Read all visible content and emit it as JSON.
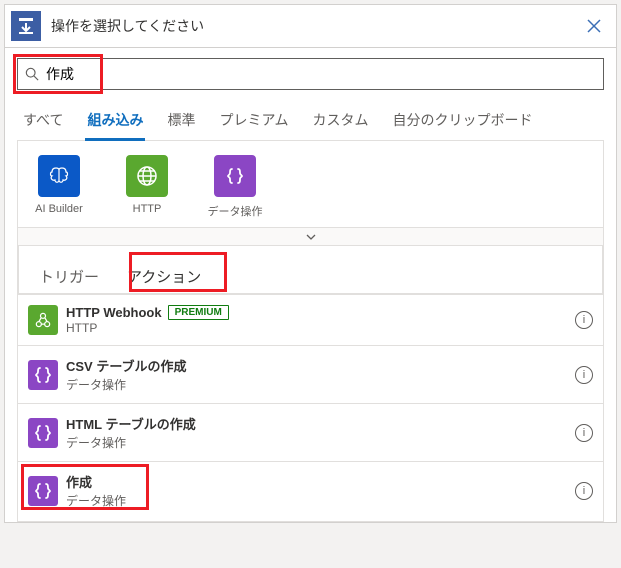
{
  "header": {
    "title": "操作を選択してください"
  },
  "search": {
    "value": "作成"
  },
  "tabs": [
    "すべて",
    "組み込み",
    "標準",
    "プレミアム",
    "カスタム",
    "自分のクリップボード"
  ],
  "activeTab": 1,
  "connectors": [
    {
      "label": "AI Builder",
      "bg": "#0b59c7",
      "icon": "brain"
    },
    {
      "label": "HTTP",
      "bg": "#5aa82f",
      "icon": "globe"
    },
    {
      "label": "データ操作",
      "bg": "#8b46c4",
      "icon": "braces"
    }
  ],
  "subtabs": {
    "triggers": "トリガー",
    "actions": "アクション"
  },
  "activeSubtab": "actions",
  "actions": [
    {
      "title": "HTTP Webhook",
      "subtitle": "HTTP",
      "bg": "#5aa82f",
      "icon": "webhook",
      "premium": true
    },
    {
      "title": "CSV テーブルの作成",
      "subtitle": "データ操作",
      "bg": "#8b46c4",
      "icon": "braces",
      "premium": false
    },
    {
      "title": "HTML テーブルの作成",
      "subtitle": "データ操作",
      "bg": "#8b46c4",
      "icon": "braces",
      "premium": false
    },
    {
      "title": "作成",
      "subtitle": "データ操作",
      "bg": "#8b46c4",
      "icon": "braces",
      "premium": false,
      "highlight": true
    }
  ],
  "premiumLabel": "PREMIUM"
}
